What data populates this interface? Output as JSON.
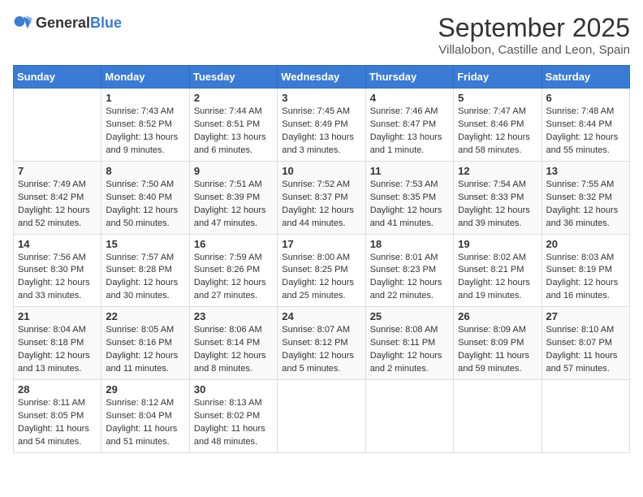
{
  "header": {
    "logo_general": "General",
    "logo_blue": "Blue",
    "month": "September 2025",
    "location": "Villalobon, Castille and Leon, Spain"
  },
  "weekdays": [
    "Sunday",
    "Monday",
    "Tuesday",
    "Wednesday",
    "Thursday",
    "Friday",
    "Saturday"
  ],
  "weeks": [
    [
      {
        "day": "",
        "info": ""
      },
      {
        "day": "1",
        "info": "Sunrise: 7:43 AM\nSunset: 8:52 PM\nDaylight: 13 hours\nand 9 minutes."
      },
      {
        "day": "2",
        "info": "Sunrise: 7:44 AM\nSunset: 8:51 PM\nDaylight: 13 hours\nand 6 minutes."
      },
      {
        "day": "3",
        "info": "Sunrise: 7:45 AM\nSunset: 8:49 PM\nDaylight: 13 hours\nand 3 minutes."
      },
      {
        "day": "4",
        "info": "Sunrise: 7:46 AM\nSunset: 8:47 PM\nDaylight: 13 hours\nand 1 minute."
      },
      {
        "day": "5",
        "info": "Sunrise: 7:47 AM\nSunset: 8:46 PM\nDaylight: 12 hours\nand 58 minutes."
      },
      {
        "day": "6",
        "info": "Sunrise: 7:48 AM\nSunset: 8:44 PM\nDaylight: 12 hours\nand 55 minutes."
      }
    ],
    [
      {
        "day": "7",
        "info": "Sunrise: 7:49 AM\nSunset: 8:42 PM\nDaylight: 12 hours\nand 52 minutes."
      },
      {
        "day": "8",
        "info": "Sunrise: 7:50 AM\nSunset: 8:40 PM\nDaylight: 12 hours\nand 50 minutes."
      },
      {
        "day": "9",
        "info": "Sunrise: 7:51 AM\nSunset: 8:39 PM\nDaylight: 12 hours\nand 47 minutes."
      },
      {
        "day": "10",
        "info": "Sunrise: 7:52 AM\nSunset: 8:37 PM\nDaylight: 12 hours\nand 44 minutes."
      },
      {
        "day": "11",
        "info": "Sunrise: 7:53 AM\nSunset: 8:35 PM\nDaylight: 12 hours\nand 41 minutes."
      },
      {
        "day": "12",
        "info": "Sunrise: 7:54 AM\nSunset: 8:33 PM\nDaylight: 12 hours\nand 39 minutes."
      },
      {
        "day": "13",
        "info": "Sunrise: 7:55 AM\nSunset: 8:32 PM\nDaylight: 12 hours\nand 36 minutes."
      }
    ],
    [
      {
        "day": "14",
        "info": "Sunrise: 7:56 AM\nSunset: 8:30 PM\nDaylight: 12 hours\nand 33 minutes."
      },
      {
        "day": "15",
        "info": "Sunrise: 7:57 AM\nSunset: 8:28 PM\nDaylight: 12 hours\nand 30 minutes."
      },
      {
        "day": "16",
        "info": "Sunrise: 7:59 AM\nSunset: 8:26 PM\nDaylight: 12 hours\nand 27 minutes."
      },
      {
        "day": "17",
        "info": "Sunrise: 8:00 AM\nSunset: 8:25 PM\nDaylight: 12 hours\nand 25 minutes."
      },
      {
        "day": "18",
        "info": "Sunrise: 8:01 AM\nSunset: 8:23 PM\nDaylight: 12 hours\nand 22 minutes."
      },
      {
        "day": "19",
        "info": "Sunrise: 8:02 AM\nSunset: 8:21 PM\nDaylight: 12 hours\nand 19 minutes."
      },
      {
        "day": "20",
        "info": "Sunrise: 8:03 AM\nSunset: 8:19 PM\nDaylight: 12 hours\nand 16 minutes."
      }
    ],
    [
      {
        "day": "21",
        "info": "Sunrise: 8:04 AM\nSunset: 8:18 PM\nDaylight: 12 hours\nand 13 minutes."
      },
      {
        "day": "22",
        "info": "Sunrise: 8:05 AM\nSunset: 8:16 PM\nDaylight: 12 hours\nand 11 minutes."
      },
      {
        "day": "23",
        "info": "Sunrise: 8:06 AM\nSunset: 8:14 PM\nDaylight: 12 hours\nand 8 minutes."
      },
      {
        "day": "24",
        "info": "Sunrise: 8:07 AM\nSunset: 8:12 PM\nDaylight: 12 hours\nand 5 minutes."
      },
      {
        "day": "25",
        "info": "Sunrise: 8:08 AM\nSunset: 8:11 PM\nDaylight: 12 hours\nand 2 minutes."
      },
      {
        "day": "26",
        "info": "Sunrise: 8:09 AM\nSunset: 8:09 PM\nDaylight: 11 hours\nand 59 minutes."
      },
      {
        "day": "27",
        "info": "Sunrise: 8:10 AM\nSunset: 8:07 PM\nDaylight: 11 hours\nand 57 minutes."
      }
    ],
    [
      {
        "day": "28",
        "info": "Sunrise: 8:11 AM\nSunset: 8:05 PM\nDaylight: 11 hours\nand 54 minutes."
      },
      {
        "day": "29",
        "info": "Sunrise: 8:12 AM\nSunset: 8:04 PM\nDaylight: 11 hours\nand 51 minutes."
      },
      {
        "day": "30",
        "info": "Sunrise: 8:13 AM\nSunset: 8:02 PM\nDaylight: 11 hours\nand 48 minutes."
      },
      {
        "day": "",
        "info": ""
      },
      {
        "day": "",
        "info": ""
      },
      {
        "day": "",
        "info": ""
      },
      {
        "day": "",
        "info": ""
      }
    ]
  ]
}
